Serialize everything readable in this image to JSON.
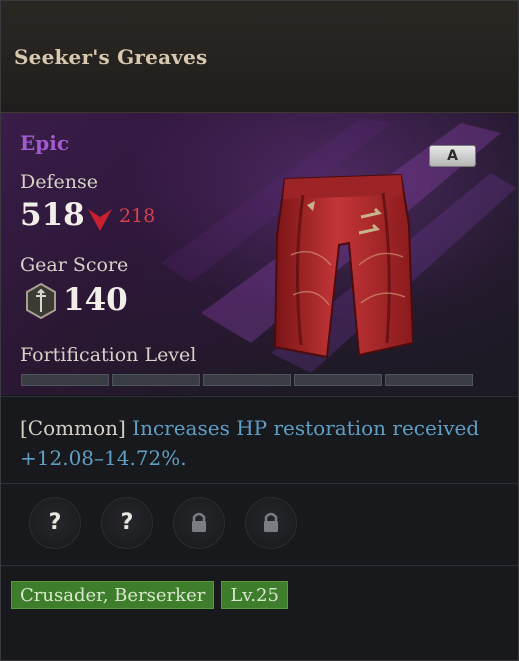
{
  "item": {
    "name": "Seeker's Greaves",
    "rarity": "Epic",
    "grade": "A"
  },
  "stats": {
    "defense_label": "Defense",
    "defense_value": "518",
    "defense_diff": "218",
    "defense_diff_direction": "down",
    "gear_score_label": "Gear Score",
    "gear_score_value": "140",
    "fortification_label": "Fortification Level",
    "fortification_segments_total": 5,
    "fortification_filled": 0
  },
  "effect": {
    "prefix": "[Common]",
    "description": "Increases HP restoration received +12.08–14.72%."
  },
  "sockets": [
    {
      "state": "unknown",
      "glyph": "?"
    },
    {
      "state": "unknown",
      "glyph": "?"
    },
    {
      "state": "locked",
      "icon": "lock-icon"
    },
    {
      "state": "locked",
      "icon": "lock-icon"
    }
  ],
  "tags": {
    "classes": "Crusader, Berserker",
    "level": "Lv.25"
  },
  "colors": {
    "rarity": "#a35bd0",
    "stat_down": "#d8404a",
    "effect_text": "#5f9fc5",
    "tag_bg": "#3e7d2b"
  }
}
